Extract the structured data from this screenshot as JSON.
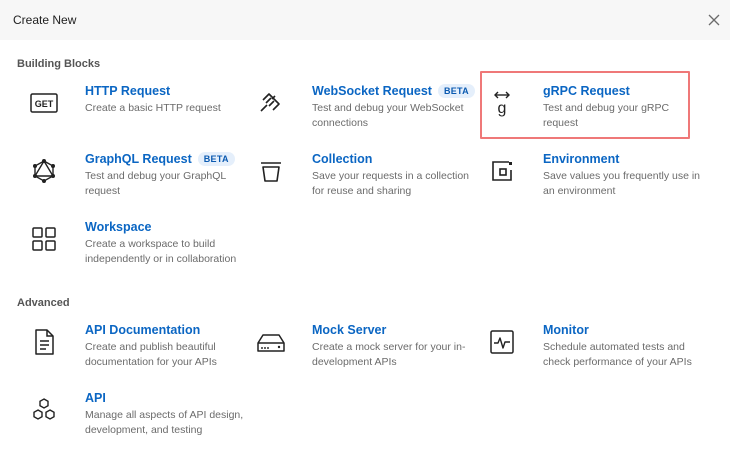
{
  "dialog": {
    "title": "Create New"
  },
  "sections": {
    "building_blocks": "Building Blocks",
    "advanced": "Advanced"
  },
  "tiles": {
    "http": {
      "name": "HTTP Request",
      "desc": "Create a basic HTTP request",
      "icon": "get-icon"
    },
    "websocket": {
      "name": "WebSocket Request",
      "badge": "BETA",
      "desc": "Test and debug your WebSocket connections",
      "icon": "websocket-icon"
    },
    "grpc": {
      "name": "gRPC Request",
      "desc": "Test and debug your gRPC request",
      "icon": "grpc-icon"
    },
    "graphql": {
      "name": "GraphQL Request",
      "badge": "BETA",
      "desc": "Test and debug your GraphQL request",
      "icon": "graphql-icon"
    },
    "collection": {
      "name": "Collection",
      "desc": "Save your requests in a collection for reuse and sharing",
      "icon": "collection-icon"
    },
    "environment": {
      "name": "Environment",
      "desc": "Save values you frequently use in an environment",
      "icon": "environment-icon"
    },
    "workspace": {
      "name": "Workspace",
      "desc": "Create a workspace to build independently or in collaboration",
      "icon": "workspace-icon"
    },
    "api_docs": {
      "name": "API Documentation",
      "desc": "Create and publish beautiful documentation for your APIs",
      "icon": "document-icon"
    },
    "mock_server": {
      "name": "Mock Server",
      "desc": "Create a mock server for your in-development APIs",
      "icon": "server-icon"
    },
    "monitor": {
      "name": "Monitor",
      "desc": "Schedule automated tests and check performance of your APIs",
      "icon": "monitor-icon"
    },
    "api": {
      "name": "API",
      "desc": "Manage all aspects of API design, development, and testing",
      "icon": "api-icon"
    }
  },
  "http_icon_text": "GET",
  "grpc_icon_text": "g",
  "highlight_color": "#ef7878",
  "link_color": "#0b66c3"
}
